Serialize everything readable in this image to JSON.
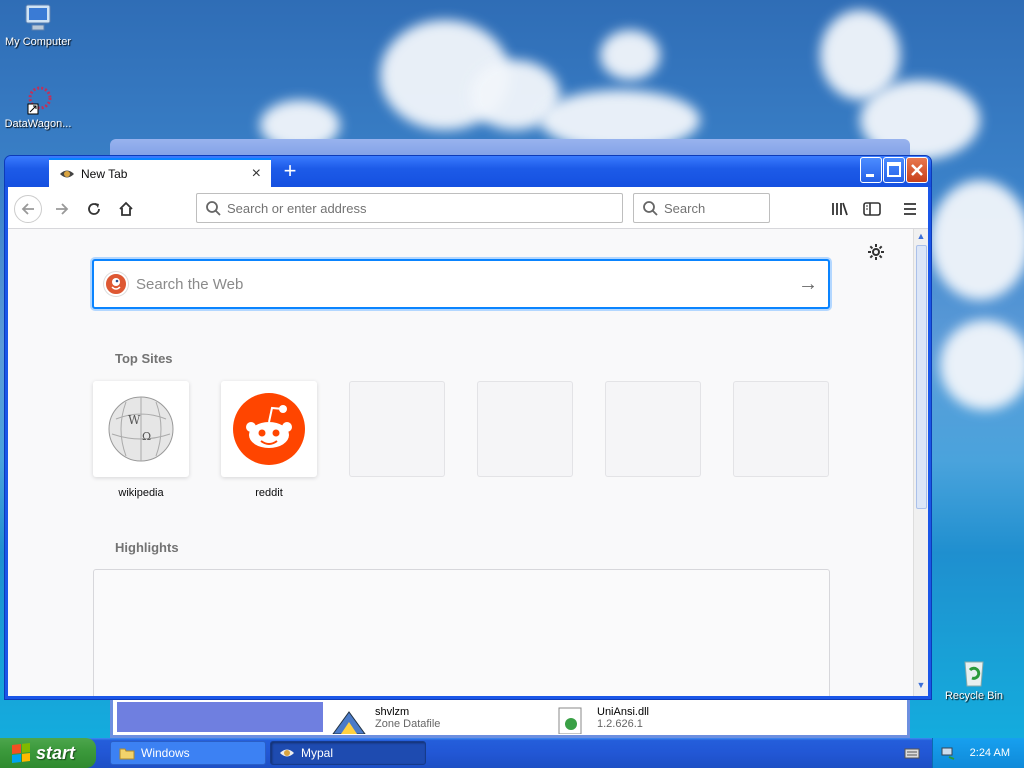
{
  "desktop": {
    "icons": [
      {
        "label": "My Computer",
        "icon": "my-computer-icon"
      },
      {
        "label": "DataWagon...",
        "icon": "datawagon-shortcut-icon"
      },
      {
        "label": "Recycle Bin",
        "icon": "recycle-bin-icon"
      }
    ]
  },
  "background_window": {
    "title": "Windows",
    "files": [
      {
        "name": "shvlzm",
        "sub": "Zone Datafile",
        "icon": "zone-datafile-icon"
      },
      {
        "name": "UniAnsi.dll",
        "sub": "1.2.626.1",
        "icon": "dll-file-icon"
      }
    ]
  },
  "browser": {
    "tab": {
      "title": "New Tab",
      "close": "×"
    },
    "new_tab_label": "+",
    "url_placeholder": "Search or enter address",
    "search_placeholder": "Search",
    "web_search_placeholder": "Search the Web",
    "web_search_arrow": "→",
    "settings_icon": "gear-icon",
    "top_sites_title": "Top Sites",
    "top_sites": [
      {
        "label": "wikipedia",
        "icon": "wikipedia-globe-icon"
      },
      {
        "label": "reddit",
        "icon": "reddit-alien-icon"
      },
      {
        "label": "",
        "icon": ""
      },
      {
        "label": "",
        "icon": ""
      },
      {
        "label": "",
        "icon": ""
      },
      {
        "label": "",
        "icon": ""
      }
    ],
    "highlights_title": "Highlights"
  },
  "taskbar": {
    "start_label": "start",
    "tasks": [
      {
        "label": "Windows",
        "icon": "folder-icon",
        "active": false
      },
      {
        "label": "Mypal",
        "icon": "mypal-icon",
        "active": true
      }
    ],
    "clock": "2:24 AM"
  },
  "colors": {
    "accent": "#0a84ff",
    "xp_blue": "#245edb",
    "reddit": "#ff4500",
    "start_green": "#3c9a3c"
  }
}
